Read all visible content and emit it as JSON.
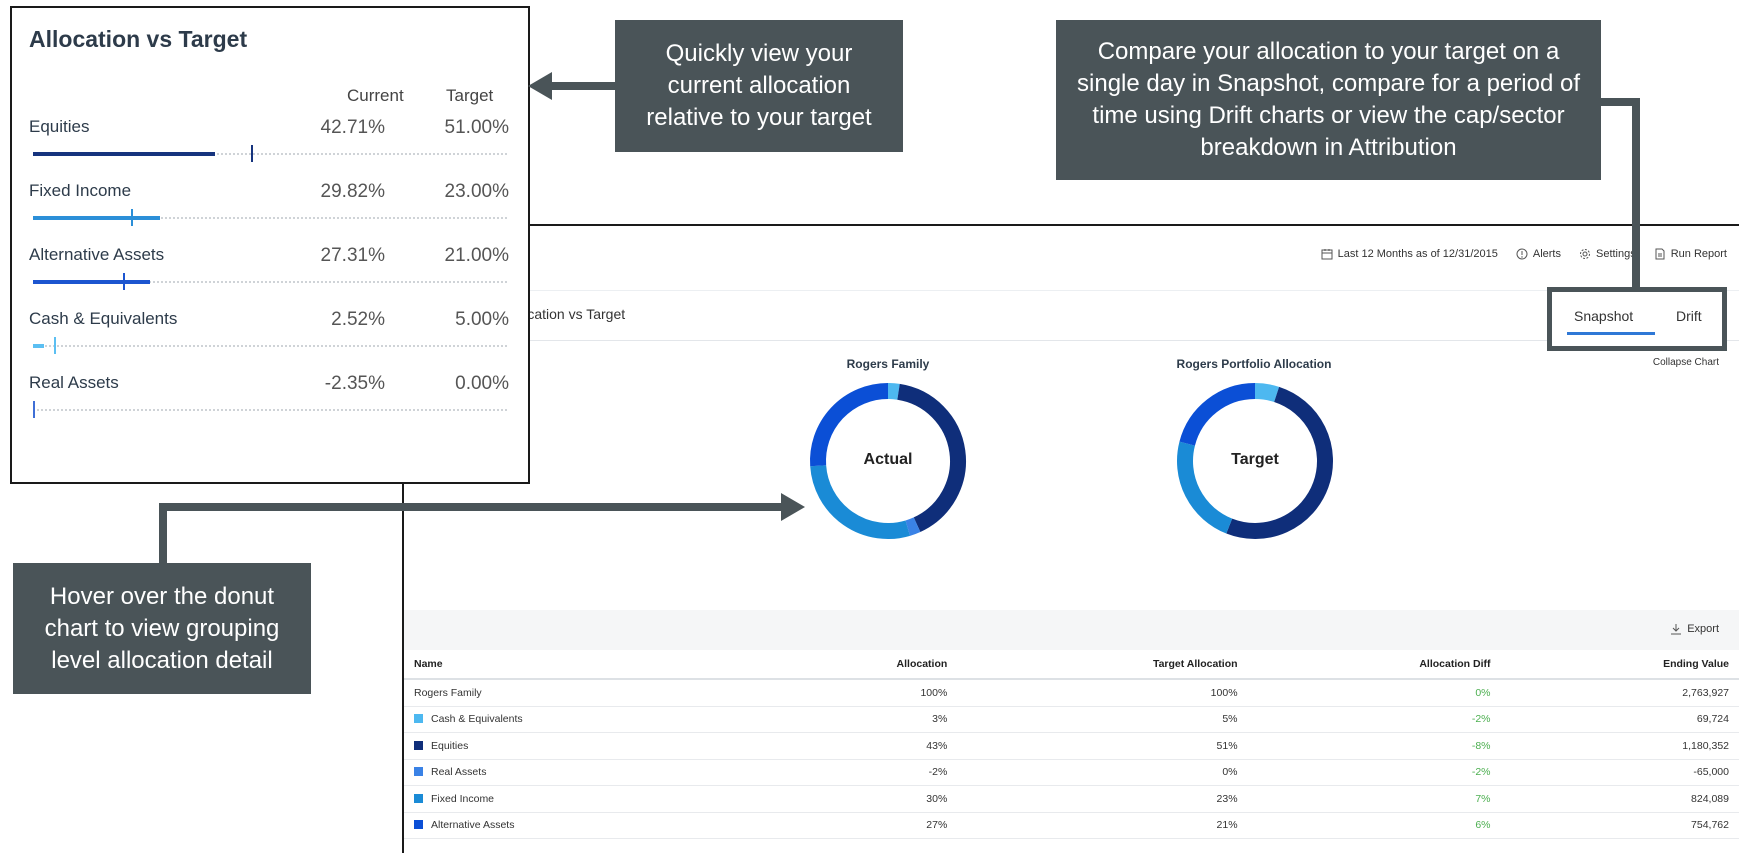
{
  "toolbar": {
    "period": "Last 12 Months as of 12/31/2015",
    "alerts": "Alerts",
    "settings": "Settings",
    "run_report": "Run Report"
  },
  "page_tab_title": "Allocation vs Target",
  "view_tabs": {
    "snapshot": "Snapshot",
    "drift": "Drift",
    "active": "Snapshot"
  },
  "collapse_chart": "Collapse Chart",
  "donuts": [
    {
      "title": "Rogers Family",
      "center": "Actual",
      "segments": [
        {
          "name": "Cash & Equivalents",
          "value": 2.52,
          "color": "#4db8f0"
        },
        {
          "name": "Equities",
          "value": 42.71,
          "color": "#0f2e7a"
        },
        {
          "name": "Real Assets",
          "value": 2.35,
          "color": "#3a82e6"
        },
        {
          "name": "Fixed Income",
          "value": 29.82,
          "color": "#1a8bd6"
        },
        {
          "name": "Alternative Assets",
          "value": 27.31,
          "color": "#0b4fd6"
        }
      ]
    },
    {
      "title": "Rogers Portfolio Allocation",
      "center": "Target",
      "segments": [
        {
          "name": "Cash & Equivalents",
          "value": 5.0,
          "color": "#4db8f0"
        },
        {
          "name": "Equities",
          "value": 51.0,
          "color": "#0f2e7a"
        },
        {
          "name": "Fixed Income",
          "value": 23.0,
          "color": "#1a8bd6"
        },
        {
          "name": "Alternative Assets",
          "value": 21.0,
          "color": "#0b4fd6"
        }
      ]
    }
  ],
  "export_label": "Export",
  "table": {
    "headers": [
      "Name",
      "Allocation",
      "Target Allocation",
      "Allocation Diff",
      "Ending Value"
    ],
    "rows": [
      {
        "name": "Rogers Family",
        "color": "",
        "allocation": "100%",
        "target": "100%",
        "diff": "0%",
        "ending": "2,763,927"
      },
      {
        "name": "Cash & Equivalents",
        "color": "#4db8f0",
        "allocation": "3%",
        "target": "5%",
        "diff": "-2%",
        "ending": "69,724"
      },
      {
        "name": "Equities",
        "color": "#0f2e7a",
        "allocation": "43%",
        "target": "51%",
        "diff": "-8%",
        "ending": "1,180,352"
      },
      {
        "name": "Real Assets",
        "color": "#3a82e6",
        "allocation": "-2%",
        "target": "0%",
        "diff": "-2%",
        "ending": "-65,000"
      },
      {
        "name": "Fixed Income",
        "color": "#1a8bd6",
        "allocation": "30%",
        "target": "23%",
        "diff": "7%",
        "ending": "824,089"
      },
      {
        "name": "Alternative Assets",
        "color": "#0b4fd6",
        "allocation": "27%",
        "target": "21%",
        "diff": "6%",
        "ending": "754,762"
      }
    ]
  },
  "avt_card": {
    "title": "Allocation vs Target",
    "col_current": "Current",
    "col_target": "Target",
    "rows": [
      {
        "name": "Equities",
        "current": "42.71%",
        "target": "51.00%",
        "current_pct": 42.71,
        "target_pct": 51.0,
        "color": "#16347e"
      },
      {
        "name": "Fixed Income",
        "current": "29.82%",
        "target": "23.00%",
        "current_pct": 29.82,
        "target_pct": 23.0,
        "color": "#2b8fd8"
      },
      {
        "name": "Alternative Assets",
        "current": "27.31%",
        "target": "21.00%",
        "current_pct": 27.31,
        "target_pct": 21.0,
        "color": "#1c55d0"
      },
      {
        "name": "Cash & Equivalents",
        "current": "2.52%",
        "target": "5.00%",
        "current_pct": 2.52,
        "target_pct": 5.0,
        "color": "#5bbff2"
      },
      {
        "name": "Real Assets",
        "current": "-2.35%",
        "target": "0.00%",
        "current_pct": -2.35,
        "target_pct": 0.0,
        "color": "#3f6fd6"
      }
    ]
  },
  "callouts": {
    "quick_view": "Quickly view your current allocation relative to your target",
    "compare": "Compare your allocation to your target on a single day in Snapshot, compare for a period of time using Drift charts or view the cap/sector breakdown in Attribution",
    "hover": "Hover over the donut chart to view grouping level allocation detail"
  }
}
